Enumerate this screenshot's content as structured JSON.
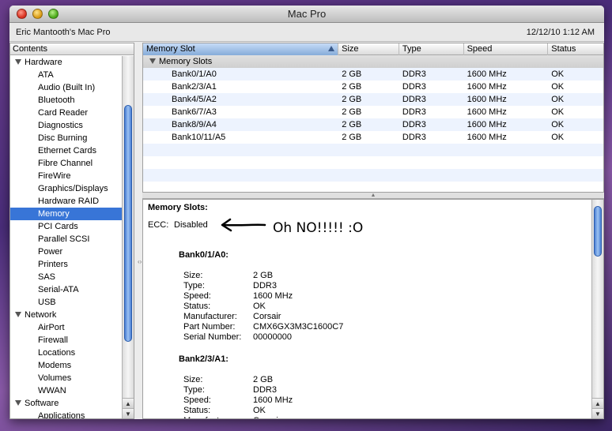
{
  "window": {
    "title": "Mac Pro"
  },
  "infobar": {
    "machine_name": "Eric Mantooth's Mac Pro",
    "date": "12/12/10 1:12 AM"
  },
  "sidebar": {
    "header": "Contents",
    "groups": [
      {
        "label": "Hardware",
        "items": [
          "ATA",
          "Audio (Built In)",
          "Bluetooth",
          "Card Reader",
          "Diagnostics",
          "Disc Burning",
          "Ethernet Cards",
          "Fibre Channel",
          "FireWire",
          "Graphics/Displays",
          "Hardware RAID",
          "Memory",
          "PCI Cards",
          "Parallel SCSI",
          "Power",
          "Printers",
          "SAS",
          "Serial-ATA",
          "USB"
        ]
      },
      {
        "label": "Network",
        "items": [
          "AirPort",
          "Firewall",
          "Locations",
          "Modems",
          "Volumes",
          "WWAN"
        ]
      },
      {
        "label": "Software",
        "items": [
          "Applications"
        ]
      }
    ],
    "selected": "Memory"
  },
  "table": {
    "columns": [
      "Memory Slot",
      "Size",
      "Type",
      "Speed",
      "Status"
    ],
    "sorted_column": "Memory Slot",
    "group_label": "Memory Slots",
    "rows": [
      [
        "Bank0/1/A0",
        "2 GB",
        "DDR3",
        "1600 MHz",
        "OK"
      ],
      [
        "Bank2/3/A1",
        "2 GB",
        "DDR3",
        "1600 MHz",
        "OK"
      ],
      [
        "Bank4/5/A2",
        "2 GB",
        "DDR3",
        "1600 MHz",
        "OK"
      ],
      [
        "Bank6/7/A3",
        "2 GB",
        "DDR3",
        "1600 MHz",
        "OK"
      ],
      [
        "Bank8/9/A4",
        "2 GB",
        "DDR3",
        "1600 MHz",
        "OK"
      ],
      [
        "Bank10/11/A5",
        "2 GB",
        "DDR3",
        "1600 MHz",
        "OK"
      ]
    ]
  },
  "details": {
    "title": "Memory Slots:",
    "ecc_label": "ECC:",
    "ecc_value": "Disabled",
    "annotation": "Oh NO!!!!! :O",
    "banks": [
      {
        "name": "Bank0/1/A0:",
        "fields": [
          [
            "Size:",
            "2 GB"
          ],
          [
            "Type:",
            "DDR3"
          ],
          [
            "Speed:",
            "1600 MHz"
          ],
          [
            "Status:",
            "OK"
          ],
          [
            "Manufacturer:",
            "Corsair"
          ],
          [
            "Part Number:",
            "CMX6GX3M3C1600C7"
          ],
          [
            "Serial Number:",
            "00000000"
          ]
        ]
      },
      {
        "name": "Bank2/3/A1:",
        "fields": [
          [
            "Size:",
            "2 GB"
          ],
          [
            "Type:",
            "DDR3"
          ],
          [
            "Speed:",
            "1600 MHz"
          ],
          [
            "Status:",
            "OK"
          ],
          [
            "Manufacturer:",
            "Corsair"
          ]
        ]
      }
    ]
  }
}
